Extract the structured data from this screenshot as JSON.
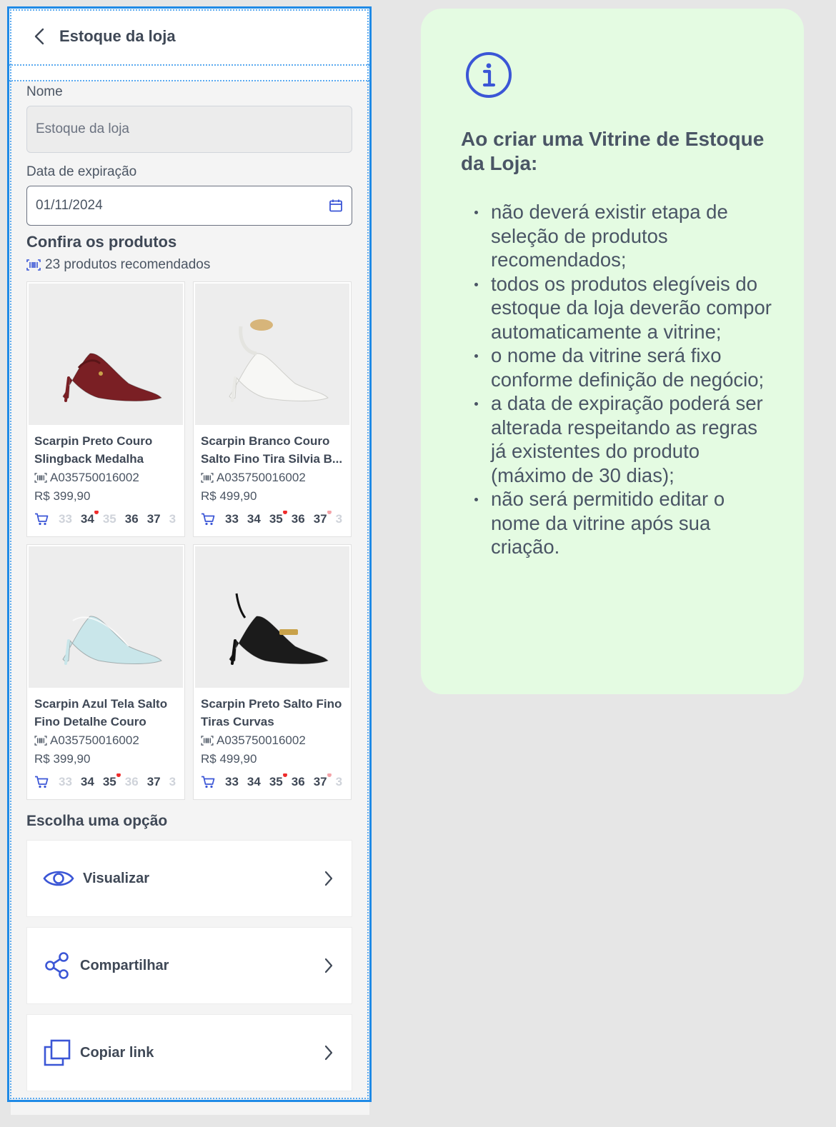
{
  "header": {
    "title": "Estoque da loja",
    "back_icon": "chevron-left-icon"
  },
  "form": {
    "name_label": "Nome",
    "name_value": "Estoque da loja",
    "date_label": "Data de expiração",
    "date_value": "01/11/2024"
  },
  "products_section": {
    "title": "Confira os produtos",
    "recommended": "23 produtos recomendados"
  },
  "products": [
    {
      "name": "Scarpin Preto Couro Slingback Medalha",
      "sku": "A035750016002",
      "price": "R$ 399,90",
      "sizes": [
        {
          "label": "33",
          "available": false,
          "dot": ""
        },
        {
          "label": "34",
          "available": true,
          "dot": "red"
        },
        {
          "label": "35",
          "available": false,
          "dot": ""
        },
        {
          "label": "36",
          "available": true,
          "dot": ""
        },
        {
          "label": "37",
          "available": true,
          "dot": ""
        },
        {
          "label": "3",
          "available": false,
          "dot": ""
        }
      ],
      "color": "#7a1f24"
    },
    {
      "name": "Scarpin Branco Couro Salto Fino Tira Silvia B...",
      "sku": "A035750016002",
      "price": "R$ 499,90",
      "sizes": [
        {
          "label": "33",
          "available": true,
          "dot": ""
        },
        {
          "label": "34",
          "available": true,
          "dot": ""
        },
        {
          "label": "35",
          "available": true,
          "dot": "red"
        },
        {
          "label": "36",
          "available": true,
          "dot": ""
        },
        {
          "label": "37",
          "available": true,
          "dot": "pink"
        },
        {
          "label": "3",
          "available": false,
          "dot": ""
        }
      ],
      "color": "#f7f7f5"
    },
    {
      "name": "Scarpin Azul Tela Salto Fino Detalhe Couro",
      "sku": "A035750016002",
      "price": "R$ 399,90",
      "sizes": [
        {
          "label": "33",
          "available": false,
          "dot": ""
        },
        {
          "label": "34",
          "available": true,
          "dot": ""
        },
        {
          "label": "35",
          "available": true,
          "dot": "red"
        },
        {
          "label": "36",
          "available": false,
          "dot": ""
        },
        {
          "label": "37",
          "available": true,
          "dot": ""
        },
        {
          "label": "3",
          "available": false,
          "dot": ""
        }
      ],
      "color": "#c9e6ea"
    },
    {
      "name": "Scarpin Preto Salto Fino Tiras Curvas",
      "sku": "A035750016002",
      "price": "R$ 499,90",
      "sizes": [
        {
          "label": "33",
          "available": true,
          "dot": ""
        },
        {
          "label": "34",
          "available": true,
          "dot": ""
        },
        {
          "label": "35",
          "available": true,
          "dot": "red"
        },
        {
          "label": "36",
          "available": true,
          "dot": ""
        },
        {
          "label": "37",
          "available": true,
          "dot": "pink"
        },
        {
          "label": "3",
          "available": false,
          "dot": ""
        }
      ],
      "color": "#1b1b1b"
    }
  ],
  "options": {
    "title": "Escolha uma opção",
    "items": [
      {
        "label": "Visualizar",
        "icon": "eye-icon"
      },
      {
        "label": "Compartilhar",
        "icon": "share-icon"
      },
      {
        "label": "Copiar link",
        "icon": "copy-icon"
      }
    ]
  },
  "info": {
    "icon": "info-icon",
    "title": "Ao criar uma Vitrine de Estoque da Loja:",
    "items": [
      "não deverá existir etapa de seleção de produtos recomendados;",
      "todos os produtos elegíveis do estoque da loja deverão compor automaticamente a vitrine;",
      "o nome da vitrine será fixo conforme definição de negócio;",
      "a data de expiração poderá ser alterada respeitando as regras já existentes do produto (máximo de 30 dias);",
      "não será permitido editar o nome da vitrine após sua criação."
    ]
  },
  "colors": {
    "accent": "#3b56d6",
    "frame": "#1f8ae6",
    "info_bg": "#e4fbe2",
    "text": "#3f4856"
  }
}
